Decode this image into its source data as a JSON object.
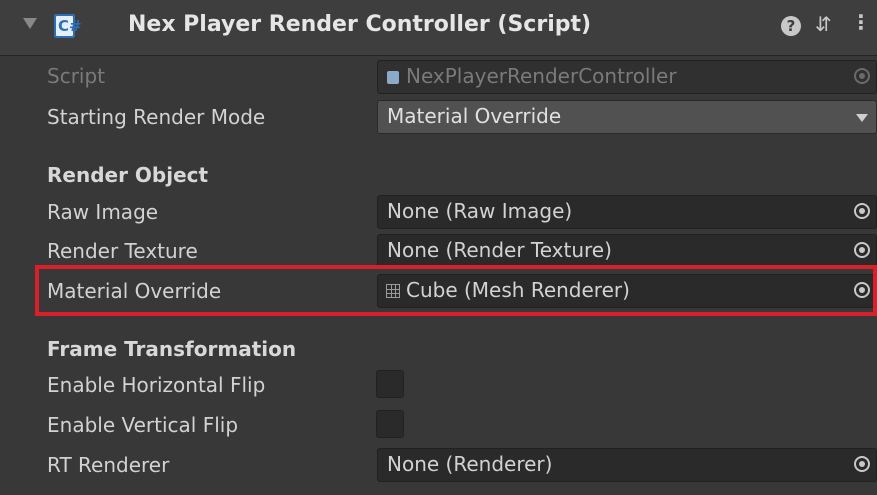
{
  "header": {
    "title": "Nex Player Render Controller (Script)",
    "script_icon_glyph": "C#",
    "help_glyph": "?",
    "preset_glyph": "⇵",
    "menu_glyph": "⋮"
  },
  "fields": {
    "script": {
      "label": "Script",
      "value": "NexPlayerRenderController"
    },
    "starting_render_mode": {
      "label": "Starting Render Mode",
      "value": "Material Override"
    }
  },
  "sections": {
    "render_object": {
      "title": "Render Object",
      "raw_image": {
        "label": "Raw Image",
        "value": "None (Raw Image)"
      },
      "render_texture": {
        "label": "Render Texture",
        "value": "None (Render Texture)"
      },
      "material_override": {
        "label": "Material Override",
        "value": "Cube (Mesh Renderer)"
      }
    },
    "frame_transformation": {
      "title": "Frame Transformation",
      "enable_horizontal_flip": {
        "label": "Enable Horizontal Flip",
        "checked": false
      },
      "enable_vertical_flip": {
        "label": "Enable Vertical Flip",
        "checked": false
      },
      "rt_renderer": {
        "label": "RT Renderer",
        "value": "None (Renderer)"
      }
    }
  },
  "colors": {
    "background": "#383838",
    "header": "#3e3e3e",
    "highlight": "#d9202a",
    "field": "#2a2a2a",
    "dropdown": "#515151"
  }
}
